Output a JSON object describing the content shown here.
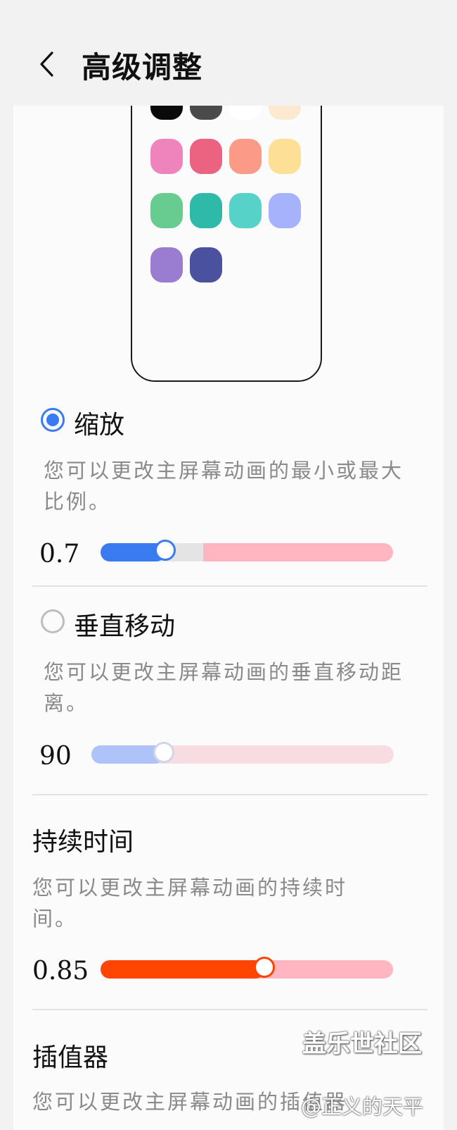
{
  "header": {
    "title": "高级调整",
    "back_icon": "chevron-left-icon"
  },
  "preview": {
    "app_colors": [
      [
        "#0a0a0a",
        "#4a4a4a",
        "#ffffff",
        "#fde8d0"
      ],
      [
        "#ef84bc",
        "#ec6382",
        "#fb9a86",
        "#fde095"
      ],
      [
        "#68cc90",
        "#2eb9a8",
        "#56d2c8",
        "#a6b2fc"
      ],
      [
        "#9a7cd0",
        "#4a52a0"
      ]
    ]
  },
  "options": {
    "zoom": {
      "label": "缩放",
      "selected": true,
      "description": "您可以更改主屏幕动画的最小或最大比例。",
      "value": "0.7",
      "slider_fraction": 0.22,
      "accent": "#3b7bf2",
      "range_end_fraction": 0.35,
      "rest_color": "#ffb6c1"
    },
    "vertical_move": {
      "label": "垂直移动",
      "selected": false,
      "description": "您可以更改主屏幕动画的垂直移动距离。",
      "value": "90",
      "slider_fraction": 0.24,
      "accent": "#aec4f8"
    },
    "duration": {
      "label": "持续时间",
      "description": "您可以更改主屏幕动画的持续时间。",
      "value": "0.85",
      "slider_fraction": 0.56,
      "accent": "#ff4500"
    },
    "interpolator": {
      "label": "插值器",
      "description": "您可以更改主屏幕动画的插值器"
    }
  },
  "watermark": {
    "line1": "盖乐世社区",
    "line2": "@正义的天平"
  }
}
